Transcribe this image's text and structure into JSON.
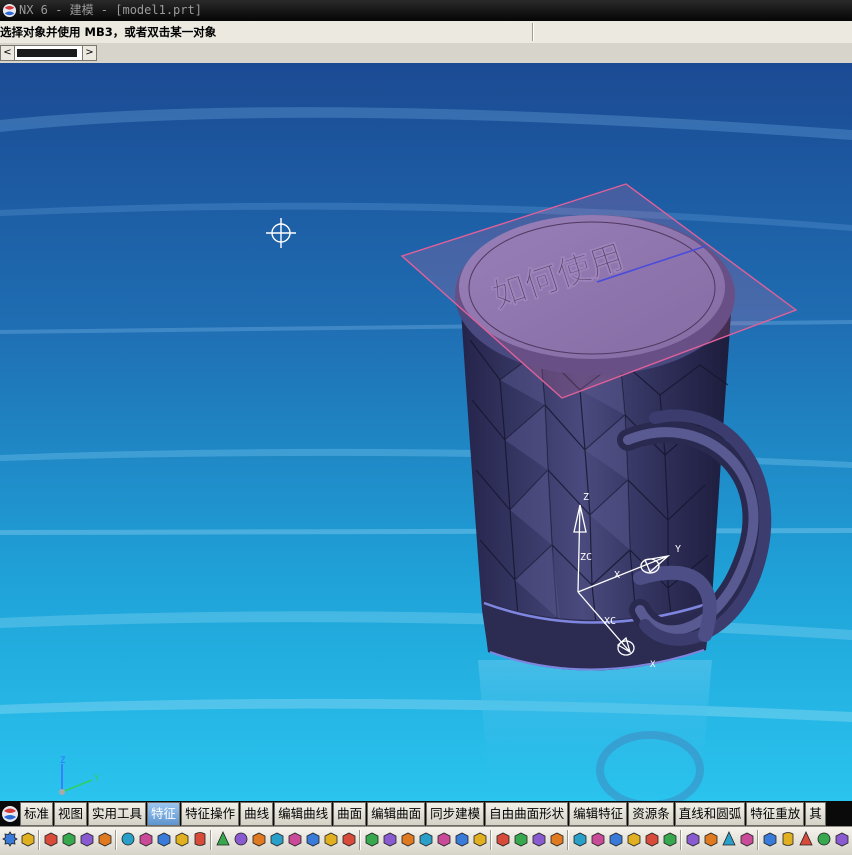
{
  "window": {
    "title": "NX 6 - 建模 - [model1.prt]"
  },
  "status": {
    "prompt": "选择对象并使用 MB3，或者双击某一对象"
  },
  "scrollbar": {
    "left_arrow": "<",
    "right_arrow": ">"
  },
  "viewport": {
    "logo_text": "如何使用",
    "triad_labels": {
      "z": "Z",
      "zc": "ZC",
      "xc": "XC",
      "x": "X",
      "y": "Y"
    },
    "mini_triad_labels": {
      "z": "Z",
      "y": "Y"
    }
  },
  "tabs": [
    "标准",
    "视图",
    "实用工具",
    "特征",
    "特征操作",
    "曲线",
    "编辑曲线",
    "曲面",
    "编辑曲面",
    "同步建模",
    "自由曲面形状",
    "编辑特征",
    "资源条",
    "直线和圆弧",
    "特征重放",
    "其"
  ],
  "active_tab": "特征",
  "colors": {
    "background_top": "#1d4e96",
    "background_bottom": "#23b8e6",
    "model": "#3d3d6a",
    "datum_plane": "#d46a9a",
    "titlebar": "#0a0a0a",
    "tab_active": "#5e95cf"
  },
  "toolbar_icons": [
    "gear-icon",
    "layers-icon",
    "sketch-icon",
    "datum-icon",
    "datum-axis-icon",
    "datum-csys-icon",
    "point-icon",
    "extrude-icon",
    "revolve-icon",
    "block-icon",
    "cylinder-icon",
    "cone-icon",
    "sphere-icon",
    "hole-icon",
    "boss-icon",
    "pocket-icon",
    "pad-icon",
    "slot-icon",
    "groove-icon",
    "emboss-icon",
    "blend-icon",
    "chamfer-icon",
    "shell-icon",
    "draft-icon",
    "thread-icon",
    "offset-face-icon",
    "pattern-icon",
    "mirror-icon",
    "trim-body-icon",
    "split-body-icon",
    "unite-icon",
    "subtract-icon",
    "intersect-icon",
    "sew-icon",
    "thicken-icon",
    "scale-icon",
    "wrap-icon",
    "sheet-icon",
    "arrow-up-icon",
    "move-icon",
    "cube-icon",
    "cylinder-solid-icon",
    "cone-solid-icon",
    "sphere-solid-icon",
    "transform-icon"
  ]
}
